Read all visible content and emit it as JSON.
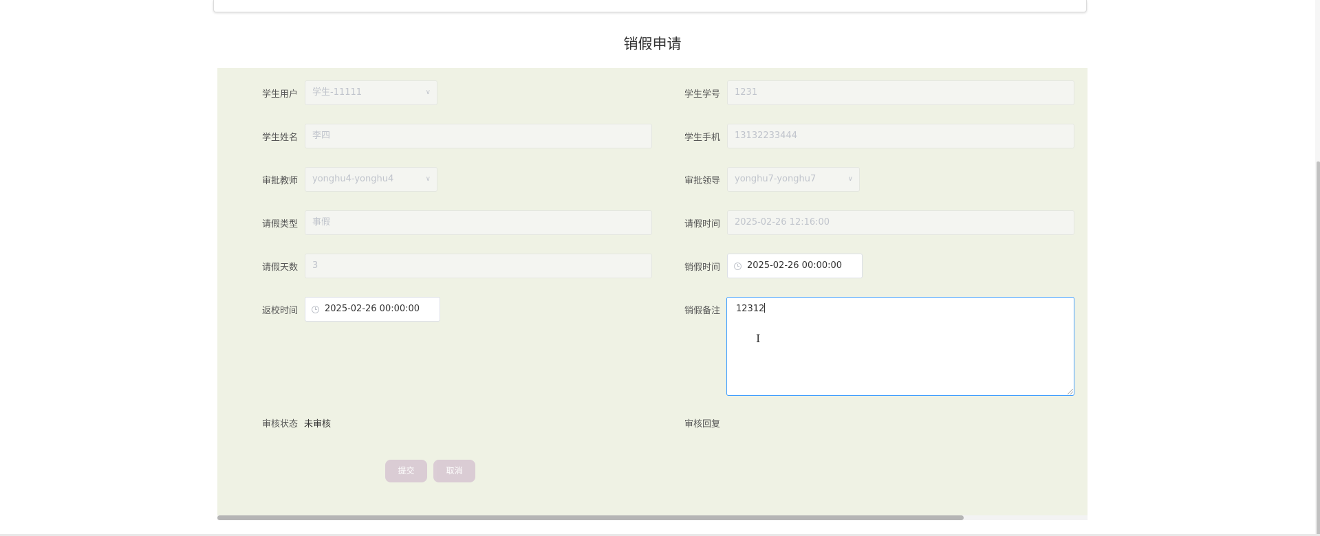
{
  "title": "销假申请",
  "fields": {
    "student_user": {
      "label": "学生用户",
      "value": "学生-11111"
    },
    "student_number": {
      "label": "学生学号",
      "value": "1231"
    },
    "student_name": {
      "label": "学生姓名",
      "value": "李四"
    },
    "student_phone": {
      "label": "学生手机",
      "value": "13132233444"
    },
    "approve_teacher": {
      "label": "审批教师",
      "value": "yonghu4-yonghu4"
    },
    "approve_leader": {
      "label": "审批领导",
      "value": "yonghu7-yonghu7"
    },
    "leave_type": {
      "label": "请假类型",
      "value": "事假"
    },
    "leave_time": {
      "label": "请假时间",
      "value": "2025-02-26 12:16:00"
    },
    "leave_days": {
      "label": "请假天数",
      "value": "3"
    },
    "cancel_time": {
      "label": "销假时间",
      "value": "2025-02-26 00:00:00"
    },
    "return_time": {
      "label": "返校时间",
      "value": "2025-02-26 00:00:00"
    },
    "cancel_note": {
      "label": "销假备注",
      "value": "12312"
    },
    "review_status": {
      "label": "审核状态",
      "value": "未审核"
    },
    "review_reply": {
      "label": "审核回复",
      "value": ""
    }
  },
  "buttons": {
    "submit": "提交",
    "cancel": "取消"
  },
  "icons": {
    "select_arrow": "chevron-down-icon",
    "date": "clock-icon",
    "cursor": "text-cursor-icon"
  },
  "colors": {
    "panel_bg": "#eff2e4",
    "focus_border": "#409eff",
    "button_bg": "#d9cad4"
  }
}
